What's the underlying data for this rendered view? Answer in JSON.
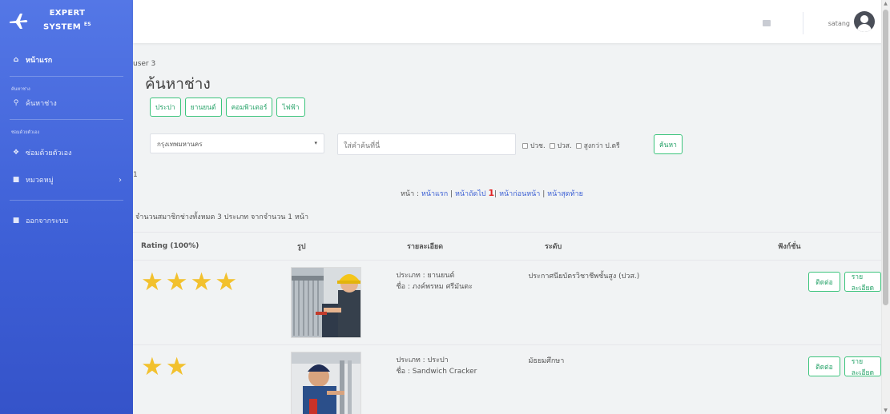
{
  "brand": {
    "line1": "EXPERT",
    "line2": "SYSTEM",
    "sup": "ES"
  },
  "sidebar": {
    "home": "หน้าแรก",
    "section_search": "ค้นหาช่าง",
    "search_item": "ค้นหาช่าง",
    "section_diy": "ซ่อมด้วยตัวเอง",
    "diy_item": "ซ่อมด้วยตัวเอง",
    "category_item": "หมวดหมู่",
    "logout_item": "ออกจากระบบ"
  },
  "topbar": {
    "username": "satang"
  },
  "content": {
    "user_label": "user 3",
    "title": "ค้นหาช่าง",
    "categories": [
      "ประปา",
      "ยานยนต์",
      "คอมพิวเตอร์",
      "ไฟฟ้า"
    ],
    "province": "กรุงเทพมหานคร",
    "search_placeholder": "ใส่คำค้นที่นี่",
    "checks": [
      "ปวช.",
      "ปวส.",
      "สูงกว่า ป.ตรี"
    ],
    "search_button": "ค้นหา",
    "marker": "1",
    "pager": {
      "prefix": "หน้า :",
      "first": "หน้าแรก",
      "next": "หน้าถัดไป",
      "current": "1",
      "prev": "หน้าก่อนหน้า",
      "last": "หน้าสุดท้าย",
      "sep": "|"
    },
    "count_text": "จำนวนสมาชิกช่างทั้งหมด 3 ประเภท จากจำนวน 1 หน้า"
  },
  "table": {
    "headers": {
      "rating": "Rating (100%)",
      "pic": "รูป",
      "detail": "รายละเอียด",
      "level": "ระดับ",
      "func": "ฟังก์ชั่น"
    },
    "rows": [
      {
        "stars": 4,
        "type": "ประเภท : ยานยนต์",
        "name": "ชื่อ : ภงค์พรหม ศรีมันตะ",
        "level": "ประกาศนียบัตรวิชาชีพชั้นสูง (ปวส.)",
        "contact": "ติดต่อ",
        "details": "รายละเอียด"
      },
      {
        "stars": 2,
        "type": "ประเภท : ประปา",
        "name": "ชื่อ : Sandwich Cracker",
        "level": "มัธยมศึกษา",
        "contact": "ติดต่อ",
        "details": "รายละเอียด"
      }
    ]
  },
  "colors": {
    "sidebar": "#4568df",
    "accent": "#2aa46b",
    "star": "#f2c12e",
    "link": "#3b5fd4",
    "current_page": "#e02424"
  },
  "icons": [
    "plane-icon",
    "home-icon",
    "search-icon",
    "wrench-icon",
    "folder-icon",
    "mail-icon",
    "avatar",
    "star-icon"
  ]
}
